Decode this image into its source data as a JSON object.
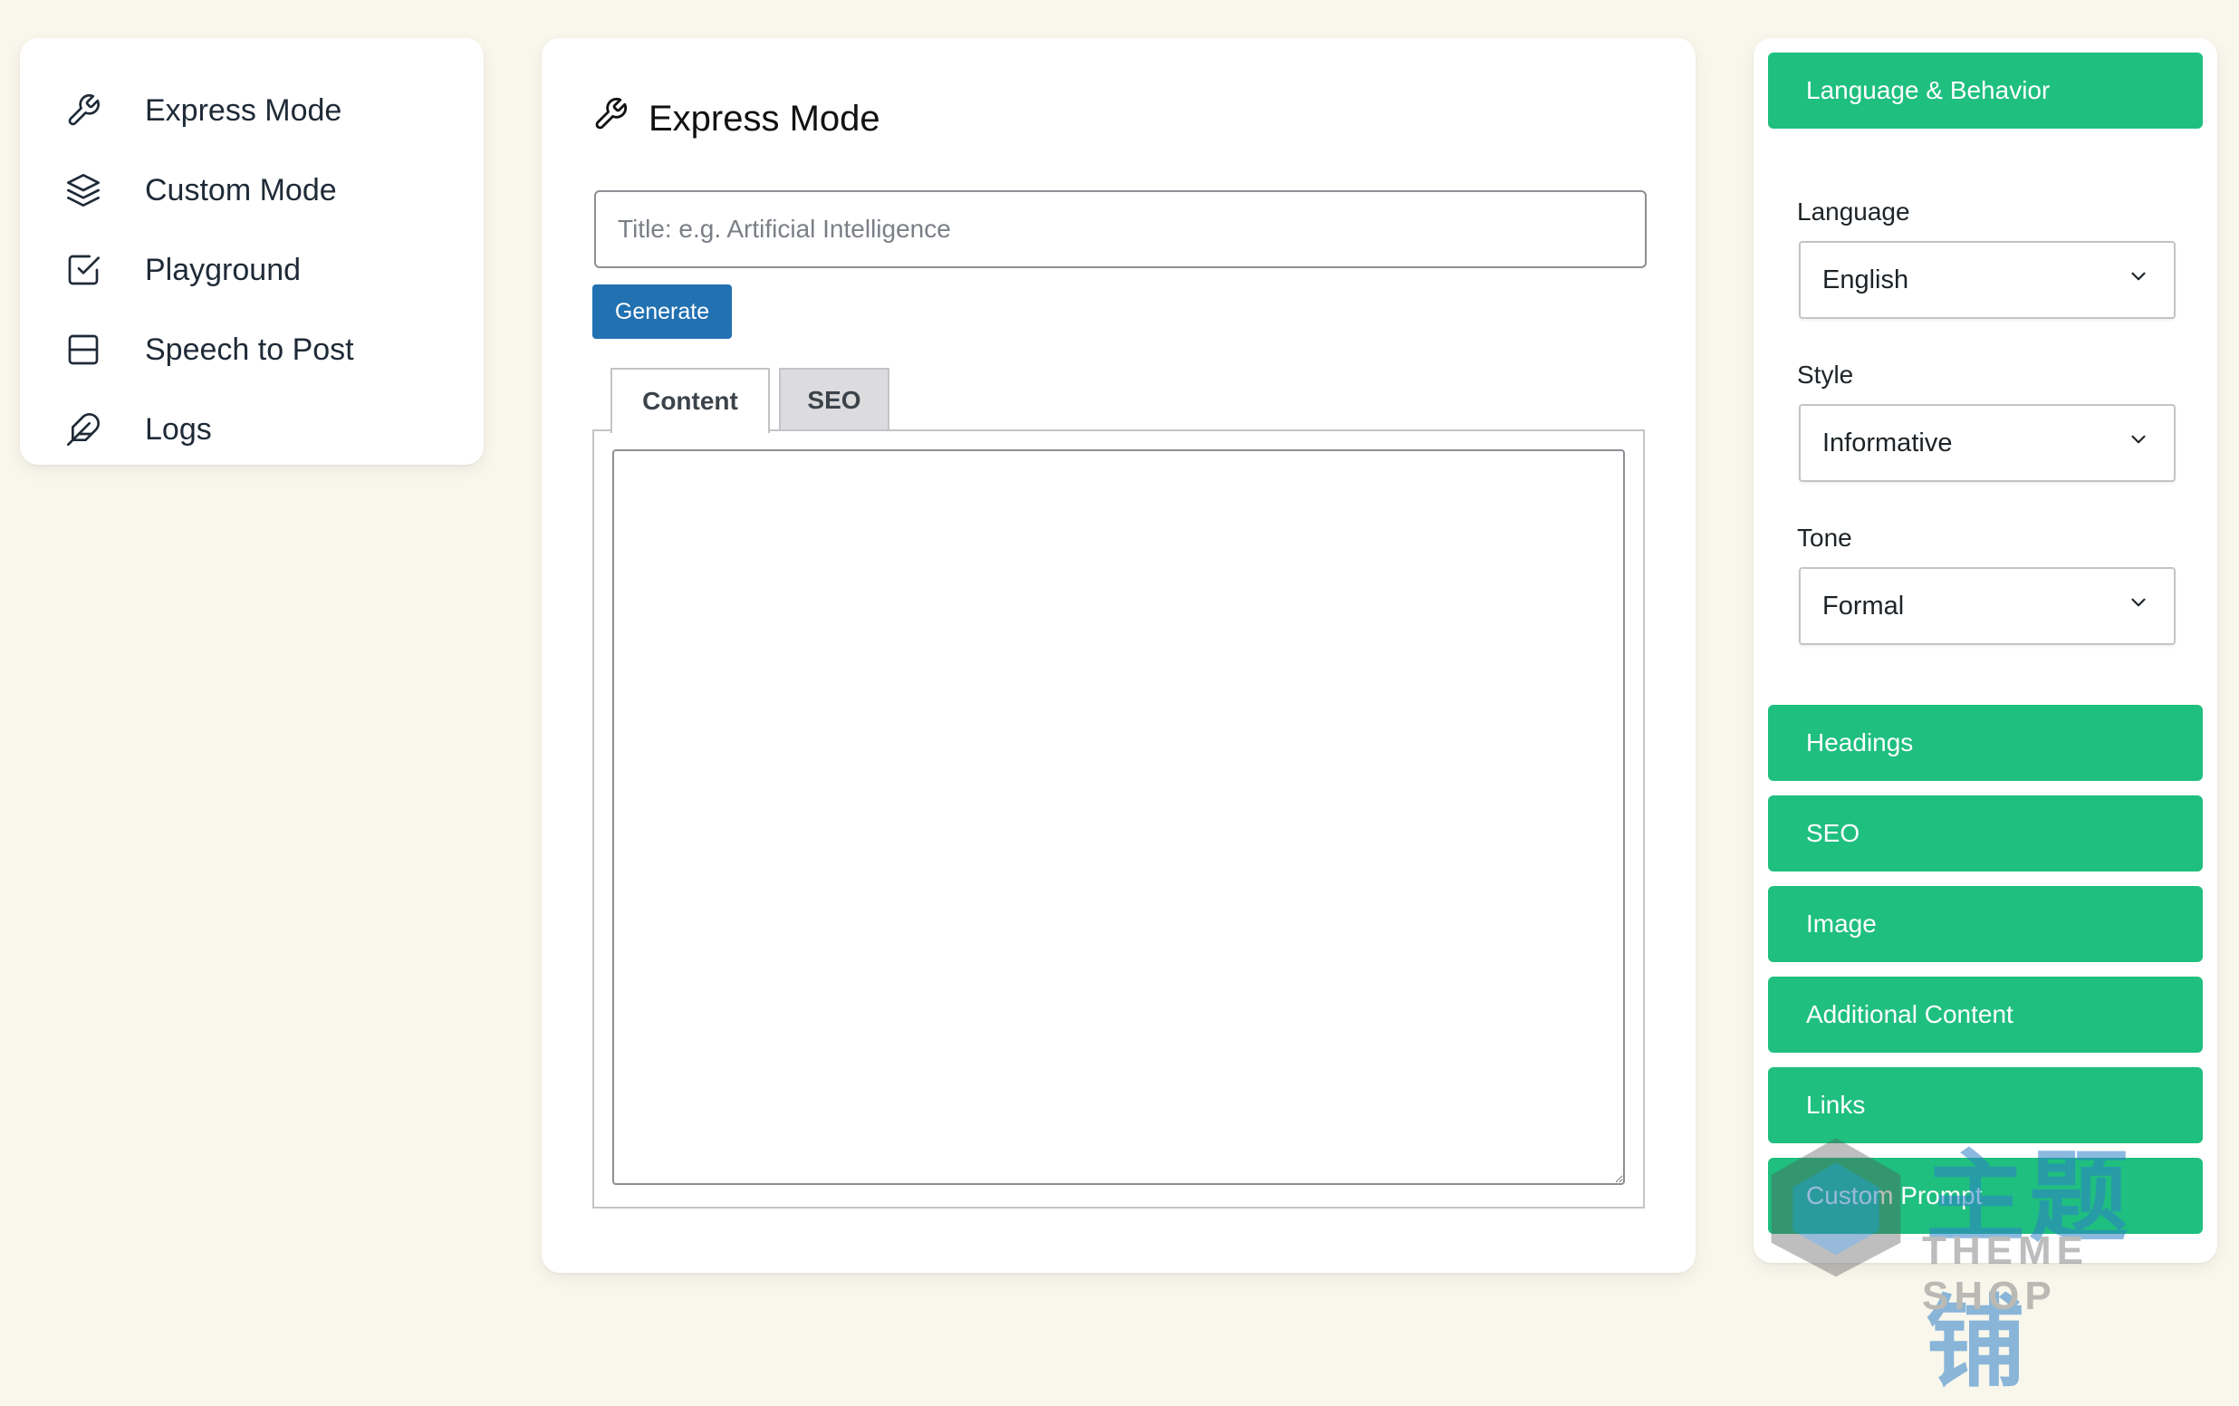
{
  "nav": {
    "items": [
      {
        "label": "Express Mode",
        "icon": "wrench-icon"
      },
      {
        "label": "Custom Mode",
        "icon": "layers-icon"
      },
      {
        "label": "Playground",
        "icon": "checkbox-icon"
      },
      {
        "label": "Speech to Post",
        "icon": "split-square-icon"
      },
      {
        "label": "Logs",
        "icon": "feather-icon"
      }
    ]
  },
  "main": {
    "title": "Express Mode",
    "title_icon": "wrench-icon",
    "title_input": {
      "placeholder": "Title: e.g. Artificial Intelligence",
      "value": ""
    },
    "generate_label": "Generate",
    "tabs": [
      {
        "label": "Content",
        "active": true
      },
      {
        "label": "SEO",
        "active": false
      }
    ],
    "content_value": ""
  },
  "sidebar": {
    "language_behavior_label": "Language & Behavior",
    "fields": {
      "language": {
        "label": "Language",
        "value": "English"
      },
      "style": {
        "label": "Style",
        "value": "Informative"
      },
      "tone": {
        "label": "Tone",
        "value": "Formal"
      }
    },
    "sections": [
      {
        "label": "Headings"
      },
      {
        "label": "SEO"
      },
      {
        "label": "Image"
      },
      {
        "label": "Additional Content"
      },
      {
        "label": "Links"
      },
      {
        "label": "Custom Prompt"
      }
    ]
  },
  "watermark": {
    "cn": "主题铺",
    "en": "THEME SHOP"
  },
  "colors": {
    "background": "#f9f7ec",
    "accent_green": "#1fbf7f",
    "primary_blue": "#2271b1"
  }
}
